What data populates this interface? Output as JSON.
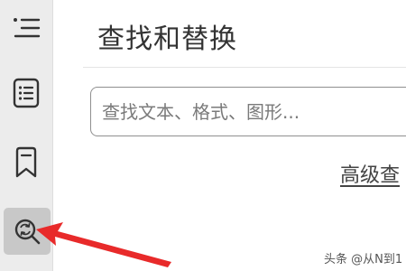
{
  "sidebar": {
    "items": [
      {
        "name": "outline-list",
        "icon": "list-icon"
      },
      {
        "name": "document",
        "icon": "document-list-icon"
      },
      {
        "name": "bookmark",
        "icon": "bookmark-icon"
      },
      {
        "name": "find-replace",
        "icon": "search-replace-icon",
        "active": true
      }
    ]
  },
  "panel": {
    "title": "查找和替换",
    "search_placeholder": "查找文本、格式、图形...",
    "advanced_link": "高级查"
  },
  "watermark": "头条 @从N到1",
  "colors": {
    "sidebar_bg": "#ececec",
    "active_item_bg": "#c8c8c8",
    "arrow": "#e82a2a",
    "text": "#333333"
  }
}
